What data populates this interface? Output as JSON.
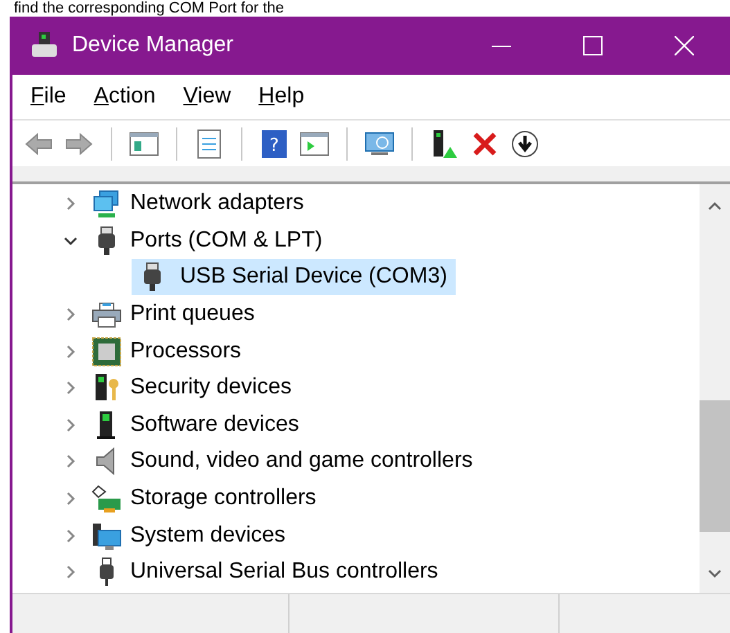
{
  "page_caption": "find the corresponding COM Port for the",
  "window": {
    "title": "Device Manager"
  },
  "toolbar": {
    "help_glyph": "?"
  },
  "menu": [
    {
      "label": "File"
    },
    {
      "label": "Action"
    },
    {
      "label": "View"
    },
    {
      "label": "Help"
    }
  ],
  "tree": [
    {
      "label": "Network adapters",
      "kind": "network",
      "expanded": false,
      "selected": false
    },
    {
      "label": "Ports (COM & LPT)",
      "kind": "port",
      "expanded": true,
      "selected": false,
      "children": [
        {
          "label": "USB Serial Device (COM3)",
          "kind": "port",
          "selected": true
        }
      ]
    },
    {
      "label": "Print queues",
      "kind": "printer",
      "expanded": false,
      "selected": false
    },
    {
      "label": "Processors",
      "kind": "processor",
      "expanded": false,
      "selected": false
    },
    {
      "label": "Security devices",
      "kind": "security",
      "expanded": false,
      "selected": false
    },
    {
      "label": "Software devices",
      "kind": "software",
      "expanded": false,
      "selected": false
    },
    {
      "label": "Sound, video and game controllers",
      "kind": "sound",
      "expanded": false,
      "selected": false
    },
    {
      "label": "Storage controllers",
      "kind": "storage",
      "expanded": false,
      "selected": false
    },
    {
      "label": "System devices",
      "kind": "system",
      "expanded": false,
      "selected": false
    },
    {
      "label": "Universal Serial Bus controllers",
      "kind": "usb",
      "expanded": false,
      "selected": false
    }
  ]
}
